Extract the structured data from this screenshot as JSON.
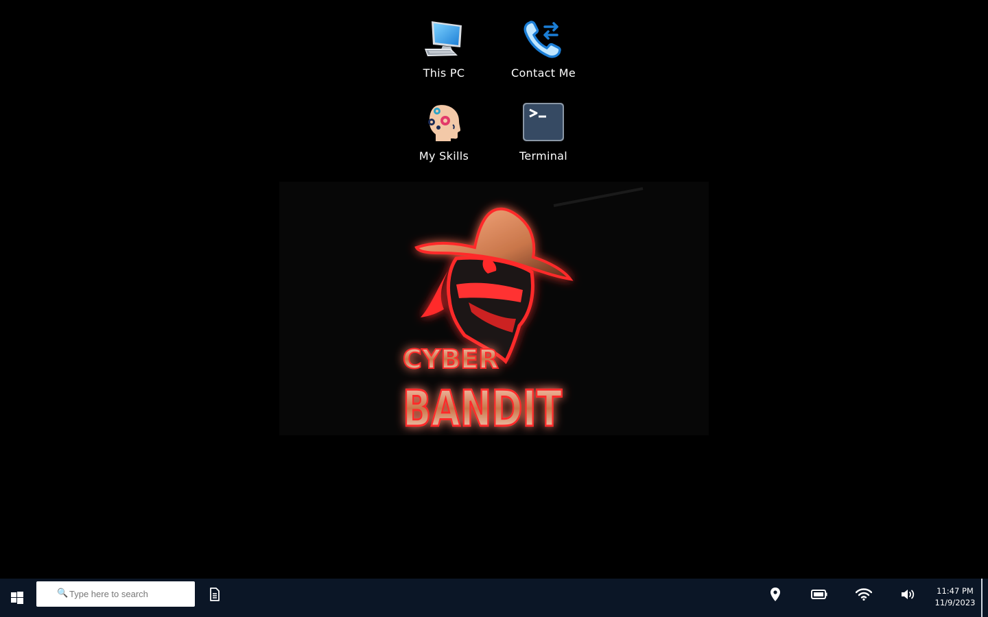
{
  "desktop": {
    "icons": [
      {
        "label": "This PC",
        "icon": "computer-icon"
      },
      {
        "label": "Contact Me",
        "icon": "phone-icon"
      },
      {
        "label": "My Skills",
        "icon": "skills-icon"
      },
      {
        "label": "Terminal",
        "icon": "terminal-icon"
      }
    ],
    "wallpaper": {
      "logo_text_top": "CYBER",
      "logo_text_bottom": "BANDIT"
    }
  },
  "taskbar": {
    "search_placeholder": "Type here to search",
    "tray": [
      "location-icon",
      "battery-icon",
      "wifi-icon",
      "volume-icon"
    ],
    "clock": {
      "time": "11:47 PM",
      "date": "11/9/2023"
    }
  },
  "colors": {
    "taskbar_bg": "#0b1626",
    "accent_red": "#ff1a1a",
    "logo_copper": "#c9764a"
  }
}
